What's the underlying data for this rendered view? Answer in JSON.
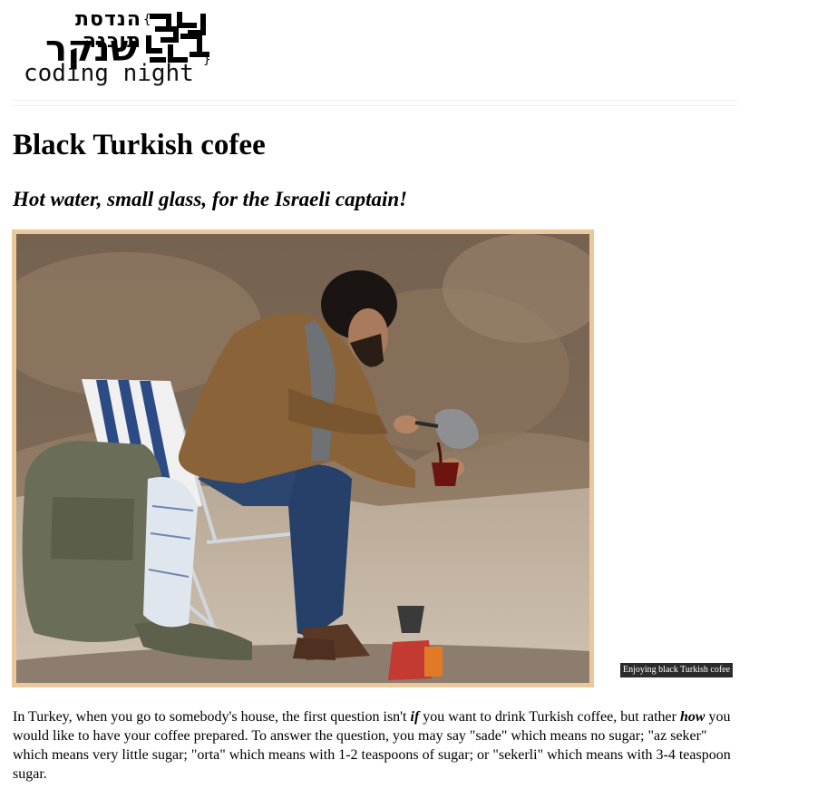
{
  "logo": {
    "hebrew_line1": "הנדסת תוכנה",
    "hebrew_line2": "שנקר",
    "tagline": "coding night"
  },
  "article": {
    "title": "Black Turkish cofee",
    "subtitle": "Hot water, small glass, for the Israeli captain!",
    "image_caption": "Enjoying black Turkish cofee",
    "paragraph": [
      "In Turkey, when you go to somebody's house, the first question isn't ",
      "if",
      " you want to drink Turkish coffee, but rather ",
      "how",
      " you would like to have your coffee prepared. To answer the question, you may say \"sade\" which means no sugar; \"az seker\" which means very little sugar; \"orta\" which means with 1-2 teaspoons of sugar; or \"sekerli\" which means with 3-4 teaspoon sugar."
    ]
  },
  "colors": {
    "image_border": "#e9c99c",
    "caption_bg": "#2b2b2b"
  }
}
